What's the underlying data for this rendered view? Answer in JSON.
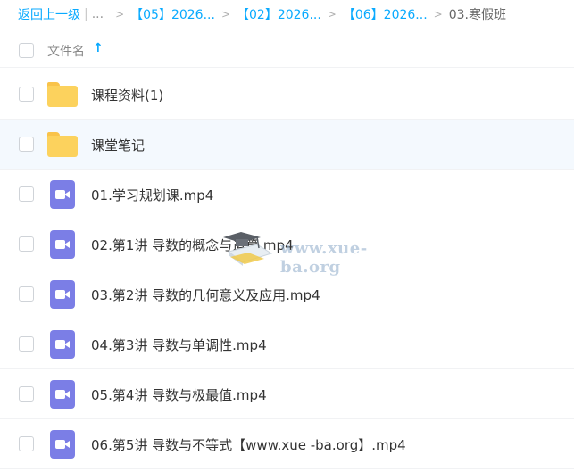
{
  "breadcrumb": {
    "back": "返回上一级",
    "ellipsis": "...",
    "crumbs": [
      "【05】2026...",
      "【02】2026...",
      "【06】2026..."
    ],
    "current": "03.寒假班"
  },
  "header": {
    "name_label": "文件名",
    "sort_icon": "arrow-up-icon"
  },
  "files": [
    {
      "name": "课程资料(1)",
      "icon": "folder-icon"
    },
    {
      "name": "课堂笔记",
      "icon": "folder-icon"
    },
    {
      "name": "01.学习规划课.mp4",
      "icon": "video-icon"
    },
    {
      "name": "02.第1讲 导数的概念与运算.mp4",
      "icon": "video-icon"
    },
    {
      "name": "03.第2讲 导数的几何意义及应用.mp4",
      "icon": "video-icon"
    },
    {
      "name": "04.第3讲 导数与单调性.mp4",
      "icon": "video-icon"
    },
    {
      "name": "05.第4讲 导数与极最值.mp4",
      "icon": "video-icon"
    },
    {
      "name": "06.第5讲 导数与不等式【www.xue -ba.org】.mp4",
      "icon": "video-icon"
    }
  ],
  "watermark": {
    "text": "www.xue-ba.org"
  },
  "colors": {
    "accent": "#09AAFF",
    "folder": "#FCD25D",
    "video": "#7B7EE6",
    "hover_row": "#F4F9FE"
  }
}
